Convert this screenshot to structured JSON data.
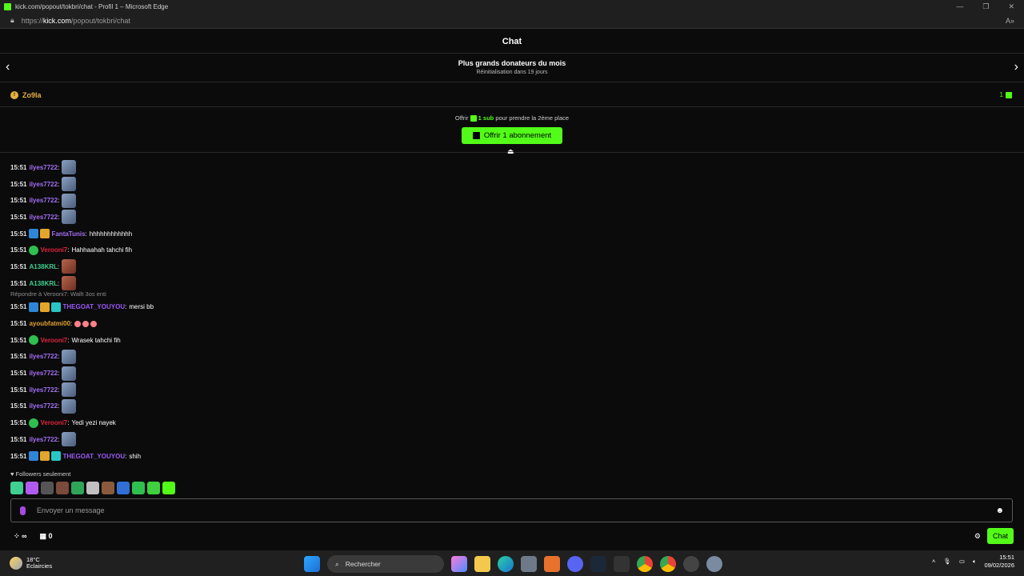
{
  "window": {
    "title": "kick.com/popout/tokbri/chat - Profil 1 – Microsoft Edge",
    "url_prefix": "https://",
    "url_host": "kick.com",
    "url_path": "/popout/tokbri/chat"
  },
  "chat": {
    "header": "Chat",
    "donors_title": "Plus grands donateurs du mois",
    "donors_reset": "Réinitialisation dans 19 jours",
    "top_donor_name": "Zo9la",
    "top_donor_count": "1",
    "offer_prefix": "Offrir",
    "offer_sub": "1 sub",
    "offer_suffix": "pour prendre la 2ème place",
    "offer_button": "Offrir 1 abonnement",
    "reply_label": "Répondre à Verooni7: Wallt 3os enti",
    "followers_label": "Followers seulement",
    "input_placeholder": "Envoyer un message",
    "bottom_infinity": "∞",
    "bottom_count": "0",
    "chat_button": "Chat"
  },
  "colors": {
    "accent": "#53fc18",
    "purple_user": "#a56ef5",
    "red_user": "#e0243b",
    "green_user": "#3fcf8e",
    "violet_user": "#9b59f5"
  },
  "messages": [
    {
      "time": "15:51",
      "user": "ilyes7722",
      "color": "#a56ef5",
      "badges": [],
      "text": "",
      "emotes": [
        "pigeon"
      ]
    },
    {
      "time": "15:51",
      "user": "ilyes7722",
      "color": "#a56ef5",
      "badges": [],
      "text": "",
      "emotes": [
        "pigeon"
      ]
    },
    {
      "time": "15:51",
      "user": "ilyes7722",
      "color": "#a56ef5",
      "badges": [],
      "text": "",
      "emotes": [
        "pigeon"
      ]
    },
    {
      "time": "15:51",
      "user": "ilyes7722",
      "color": "#a56ef5",
      "badges": [],
      "text": "",
      "emotes": [
        "pigeon"
      ]
    },
    {
      "time": "15:51",
      "user": "FantaTunis",
      "color": "#a56ef5",
      "badges": [
        "blue",
        "gold"
      ],
      "text": "hhhhhhhhhhhh",
      "emotes": []
    },
    {
      "time": "15:51",
      "user": "Verooni7",
      "color": "#e0243b",
      "badges": [
        "green"
      ],
      "text": "Hahhaahah tahchi fih",
      "emotes": []
    },
    {
      "time": "15:51",
      "user": "A138KRL",
      "color": "#3fcf8e",
      "badges": [],
      "text": "",
      "emotes": [
        "face"
      ]
    },
    {
      "time": "15:51",
      "user": "A138KRL",
      "color": "#3fcf8e",
      "badges": [],
      "text": "",
      "emotes": [
        "face"
      ]
    },
    {
      "time": "15:51",
      "user": "THEGOAT_YOUYOU",
      "color": "#9b59f5",
      "badges": [
        "blue",
        "gold",
        "teal"
      ],
      "text": "mersi bb",
      "emotes": [],
      "reply": true
    },
    {
      "time": "15:51",
      "user": "ayoubfatmi00",
      "color": "#e0a030",
      "badges": [],
      "text": "",
      "emotes": [
        "smile",
        "smile",
        "smile"
      ]
    },
    {
      "time": "15:51",
      "user": "Verooni7",
      "color": "#e0243b",
      "badges": [
        "green"
      ],
      "text": "Wrasek tahchi fih",
      "emotes": []
    },
    {
      "time": "15:51",
      "user": "ilyes7722",
      "color": "#a56ef5",
      "badges": [],
      "text": "",
      "emotes": [
        "pigeon"
      ]
    },
    {
      "time": "15:51",
      "user": "ilyes7722",
      "color": "#a56ef5",
      "badges": [],
      "text": "",
      "emotes": [
        "pigeon"
      ]
    },
    {
      "time": "15:51",
      "user": "ilyes7722",
      "color": "#a56ef5",
      "badges": [],
      "text": "",
      "emotes": [
        "pigeon"
      ]
    },
    {
      "time": "15:51",
      "user": "ilyes7722",
      "color": "#a56ef5",
      "badges": [],
      "text": "",
      "emotes": [
        "pigeon"
      ]
    },
    {
      "time": "15:51",
      "user": "Verooni7",
      "color": "#e0243b",
      "badges": [
        "green"
      ],
      "text": "Yedi yezi nayek",
      "emotes": []
    },
    {
      "time": "15:51",
      "user": "ilyes7722",
      "color": "#a56ef5",
      "badges": [],
      "text": "",
      "emotes": [
        "pigeon"
      ]
    },
    {
      "time": "15:51",
      "user": "THEGOAT_YOUYOU",
      "color": "#9b59f5",
      "badges": [
        "blue",
        "gold",
        "teal"
      ],
      "text": "shih",
      "emotes": []
    }
  ],
  "emote_bar_icons": [
    "emote-1",
    "emote-2",
    "emote-3",
    "emote-4",
    "emote-5",
    "emote-6",
    "emote-7",
    "emote-8",
    "emote-9",
    "emote-10",
    "emote-11"
  ],
  "taskbar": {
    "temperature": "18°C",
    "weather": "Eclaircies",
    "search": "Rechercher",
    "time": "15:51",
    "date": "09/02/2026"
  }
}
